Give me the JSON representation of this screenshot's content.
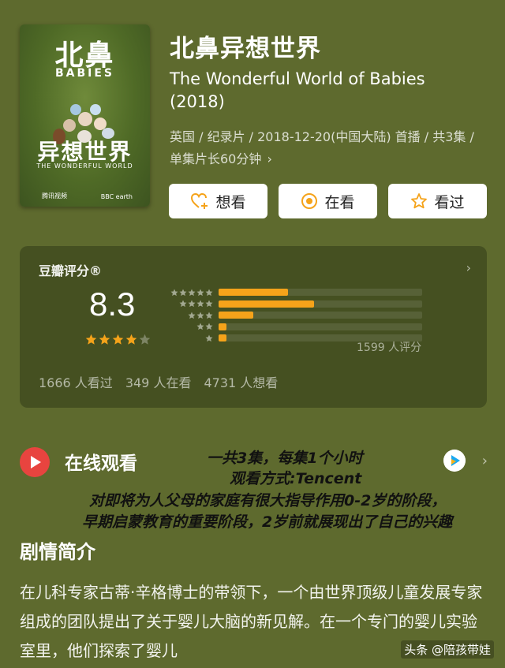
{
  "poster": {
    "title_cn": "北鼻",
    "title_en": "BABIES",
    "subtitle_cn": "异想世界",
    "subtitle_en": "THE WONDERFUL WORLD",
    "brand_left": "腾讯视频",
    "brand_right": "BBC earth"
  },
  "title_cn": "北鼻异想世界",
  "title_en": "The Wonderful World of Babies (2018)",
  "meta": "英国 / 纪录片 / 2018-12-20(中国大陆) 首播 / 共3集 / 单集片长60分钟",
  "meta_chevron": "›",
  "actions": [
    {
      "label": "想看",
      "icon": "heart-plus-icon"
    },
    {
      "label": "在看",
      "icon": "watching-icon"
    },
    {
      "label": "看过",
      "icon": "star-outline-icon"
    }
  ],
  "rating": {
    "label": "豆瓣评分®",
    "score": "8.3",
    "stars": 4,
    "distribution": [
      {
        "stars": 5,
        "fraction": 0.34
      },
      {
        "stars": 4,
        "fraction": 0.47
      },
      {
        "stars": 3,
        "fraction": 0.17
      },
      {
        "stars": 2,
        "fraction": 0.04
      },
      {
        "stars": 1,
        "fraction": 0.04
      }
    ],
    "count_text": "1599 人评分",
    "watched": "1666 人看过",
    "watching": "349 人在看",
    "want": "4731 人想看"
  },
  "online": {
    "label": "在线观看",
    "chevron": "›"
  },
  "overlay_lines": [
    "一共3集，每集1个小时",
    "观看方式:Tencent",
    "对即将为人父母的家庭有很大指导作用0-2岁的阶段，",
    "早期启蒙教育的重要阶段，2岁前就展现出了自己的兴趣"
  ],
  "synopsis": {
    "title": "剧情简介",
    "text": "在儿科专家古蒂·辛格博士的带领下，一个由世界顶级儿童发展专家组成的团队提出了关于婴儿大脑的新见解。在一个专门的婴儿实验室里，他们探索了婴儿"
  },
  "watermark": "头条 @陪孩带娃",
  "colors": {
    "background": "#5e6a2e",
    "accent": "#f5a31a",
    "play": "#e8443f"
  }
}
